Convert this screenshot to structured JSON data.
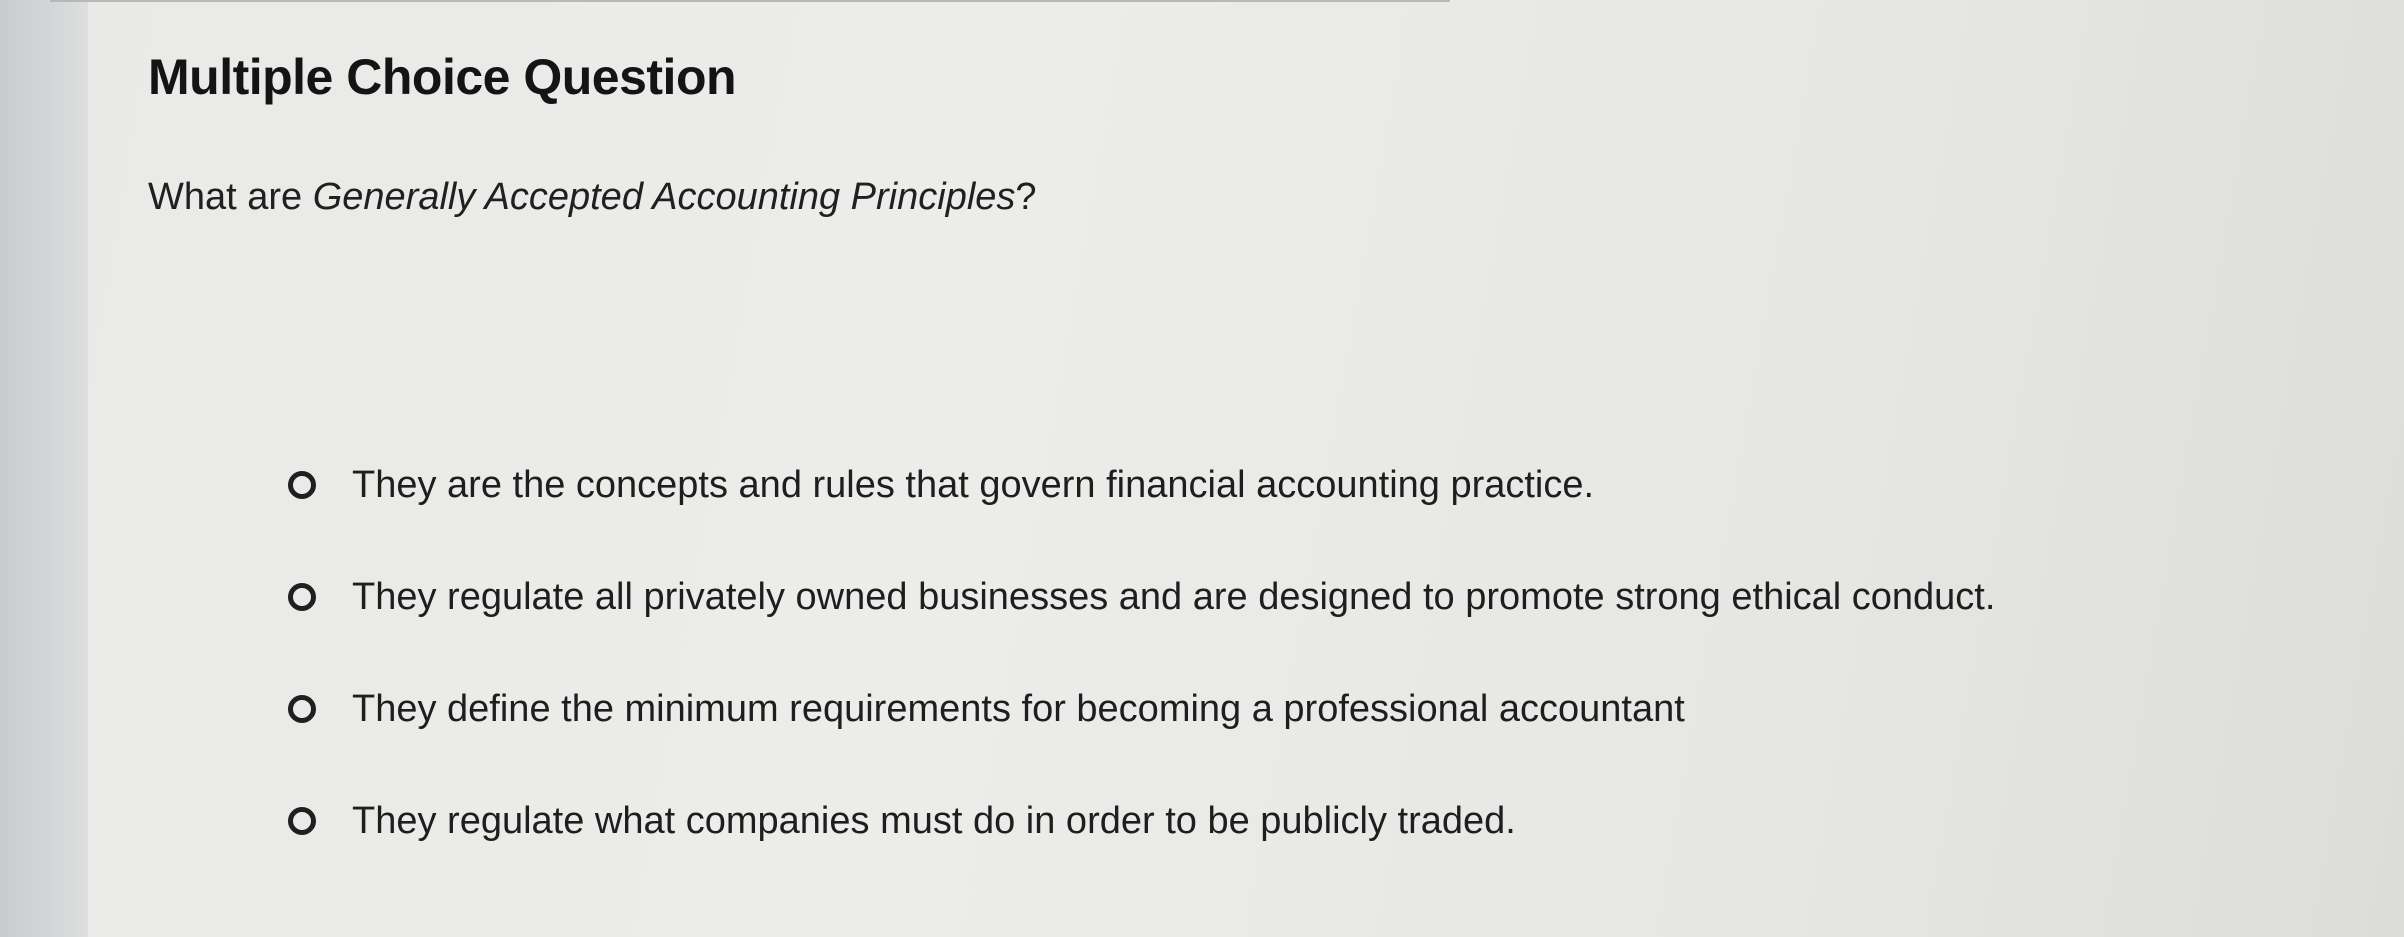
{
  "question_card": {
    "title": "Multiple Choice Question",
    "prompt_prefix": "What are ",
    "prompt_italic": "Generally Accepted Accounting Principles",
    "prompt_suffix": "?",
    "options": [
      {
        "label": "They are the concepts and rules that govern financial accounting practice.",
        "selected": false
      },
      {
        "label": "They regulate all privately owned businesses and are designed to promote strong ethical conduct.",
        "selected": false
      },
      {
        "label": "They define the minimum requirements for becoming a professional accountant",
        "selected": false
      },
      {
        "label": "They regulate what companies must do in order to be publicly traded.",
        "selected": false
      }
    ]
  },
  "icons": {
    "radio": "radio-unselected-icon"
  }
}
